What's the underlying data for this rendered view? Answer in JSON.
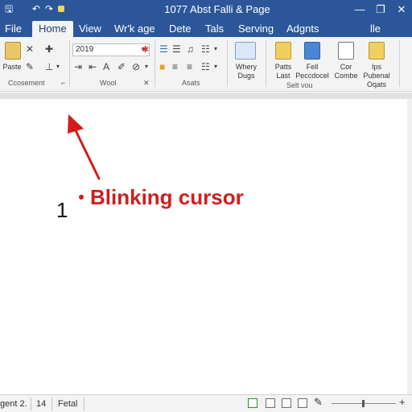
{
  "titlebar": {
    "title": "1077 Abst Falli & Page",
    "minimize": "—",
    "restore": "❐",
    "close": "✕",
    "qa_save": "🖫",
    "qa_undo": "↶",
    "qa_redo": "↷"
  },
  "tabs": [
    {
      "label": "File"
    },
    {
      "label": "Home"
    },
    {
      "label": "View"
    },
    {
      "label": "Wr'k age"
    },
    {
      "label": "Dete"
    },
    {
      "label": "Tals"
    },
    {
      "label": "Serving"
    },
    {
      "label": "Adgnts"
    },
    {
      "label": "lle"
    }
  ],
  "ribbon": {
    "clipboard": {
      "paste_label": "Paste",
      "group_label": "Ccosement"
    },
    "font": {
      "font_value": "2019",
      "group_label": "Wool"
    },
    "paragraph": {
      "group_label": "Asats"
    },
    "view": {
      "label1": "Whery",
      "label2": "Dugs"
    },
    "editing": {
      "b1a": "Patts",
      "b1b": "Last",
      "b2a": "Fell",
      "b2b": "Peccdocel",
      "b3a": "Cor",
      "b3b": "Combe",
      "b4a": "Ips",
      "b4b": "Pubenal",
      "b4c": "Oqats",
      "group_label": "Selt vou"
    }
  },
  "document": {
    "line_number": "1",
    "annotation": "Blinking cursor"
  },
  "status": {
    "page": "gent 2.",
    "words": "14",
    "lang": "Fetal"
  },
  "colors": {
    "title_bar": "#2b579a",
    "annotation": "#d21c1c"
  }
}
